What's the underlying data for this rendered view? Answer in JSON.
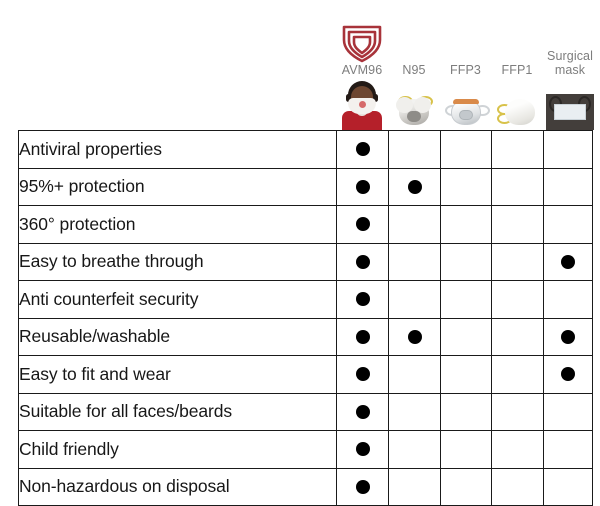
{
  "header": {
    "brand_color": "#a8333a",
    "label_color": "#7d7d7d",
    "columns": [
      {
        "id": "avm96",
        "label": "AVM96",
        "icon": "avm96-shield-logo",
        "image": "person-wearing-avm96-mask"
      },
      {
        "id": "n95",
        "label": "N95",
        "image": "n95-respirator-mask"
      },
      {
        "id": "ffp3",
        "label": "FFP3",
        "image": "ffp3-respirator-mask"
      },
      {
        "id": "ffp1",
        "label": "FFP1",
        "image": "ffp1-respirator-mask"
      },
      {
        "id": "surgical",
        "label": "Surgical\nmask",
        "image": "surgical-mask"
      }
    ]
  },
  "table": {
    "dot_color": "#000000",
    "rows": [
      {
        "feature": "Antiviral properties",
        "marks": [
          true,
          false,
          false,
          false,
          false
        ]
      },
      {
        "feature": "95%+ protection",
        "marks": [
          true,
          true,
          false,
          false,
          false
        ]
      },
      {
        "feature": "360° protection",
        "marks": [
          true,
          false,
          false,
          false,
          false
        ]
      },
      {
        "feature": "Easy to breathe through",
        "marks": [
          true,
          false,
          false,
          false,
          true
        ]
      },
      {
        "feature": "Anti counterfeit security",
        "marks": [
          true,
          false,
          false,
          false,
          false
        ]
      },
      {
        "feature": "Reusable/washable",
        "marks": [
          true,
          true,
          false,
          false,
          true
        ]
      },
      {
        "feature": "Easy to fit and wear",
        "marks": [
          true,
          false,
          false,
          false,
          true
        ]
      },
      {
        "feature": "Suitable for all faces/beards",
        "marks": [
          true,
          false,
          false,
          false,
          false
        ]
      },
      {
        "feature": "Child friendly",
        "marks": [
          true,
          false,
          false,
          false,
          false
        ]
      },
      {
        "feature": "Non-hazardous on disposal",
        "marks": [
          true,
          false,
          false,
          false,
          false
        ]
      }
    ]
  }
}
